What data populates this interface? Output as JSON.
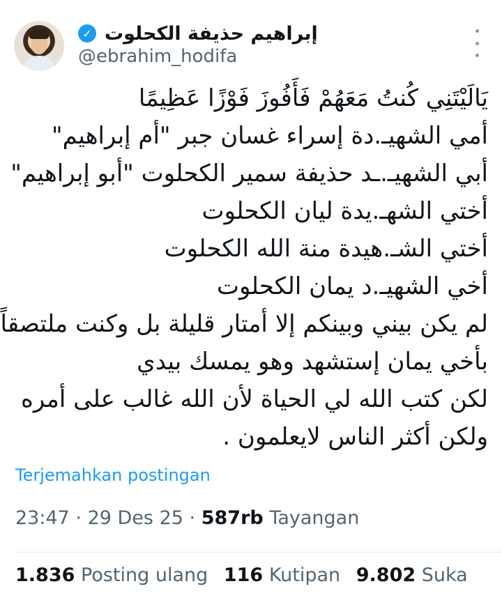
{
  "author": {
    "display_name": "إبراهيم حذيفة الكحلوت",
    "handle": "@ebrahim_hodifa",
    "verified_icon": "verified-badge-icon",
    "avatar": "avatar"
  },
  "tweet": {
    "lines": [
      "يَالَيْتَنِي كُنتُ مَعَهُمْ فَأَفُوزَ فَوْزًا عَظِيمًا",
      "أمي الشهيـ.دة إسراء غسان جبر \"أم إبراهيم\"",
      "أبي الشهيـ.ـد حذيفة سمير الكحلوت \"أبو إبراهيم\"",
      "أختي الشهـ.يدة ليان الكحلوت",
      "أختي الشـ.هيدة منة الله الكحلوت",
      "أخي الشهيـ.د يمان الكحلوت",
      "لم يكن بيني وبينكم إلا أمتار قليلة بل وكنت ملتصقاً",
      "بأخي يمان إستشهد وهو يمسك بيدي",
      "لكن كتب الله لي الحياة لأن الله غالب على أمره",
      "ولكن أكثر الناس لايعلمون ."
    ],
    "translate_label": "Terjemahkan postingan"
  },
  "meta": {
    "time": "23:47",
    "date": "29 Des 25",
    "views_count": "587rb",
    "views_label": "Tayangan"
  },
  "stats": {
    "reposts_count": "1.836",
    "reposts_label": "Posting ulang",
    "quotes_count": "116",
    "quotes_label": "Kutipan",
    "likes_count": "9.802",
    "likes_label": "Suka"
  },
  "colors": {
    "accent": "#1d9bf0",
    "text": "#0f1419",
    "secondary": "#536471"
  }
}
